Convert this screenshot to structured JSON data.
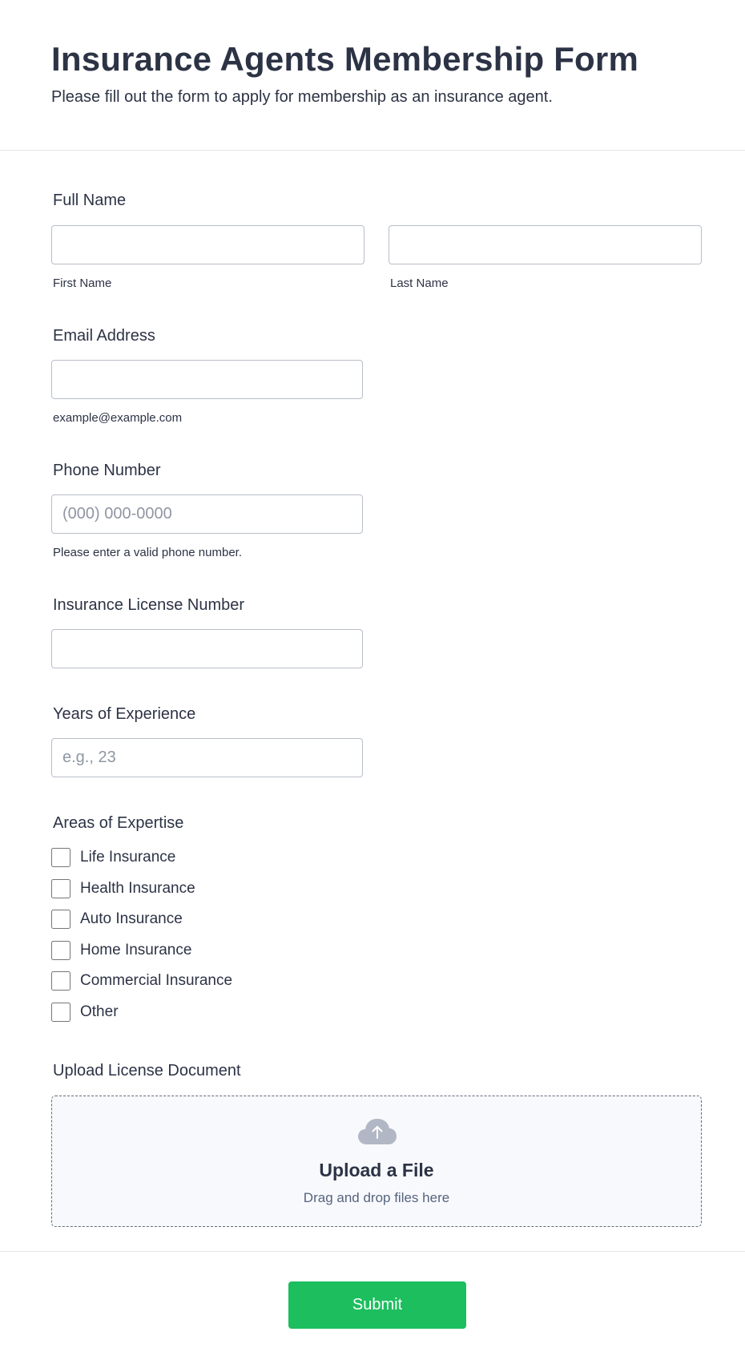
{
  "header": {
    "title": "Insurance Agents Membership Form",
    "subtitle": "Please fill out the form to apply for membership as an insurance agent."
  },
  "full_name": {
    "label": "Full Name",
    "first": {
      "value": "",
      "placeholder": "",
      "sublabel": "First Name"
    },
    "last": {
      "value": "",
      "placeholder": "",
      "sublabel": "Last Name"
    }
  },
  "email": {
    "label": "Email Address",
    "value": "",
    "placeholder": "",
    "sublabel": "example@example.com"
  },
  "phone": {
    "label": "Phone Number",
    "value": "",
    "placeholder": "(000) 000-0000",
    "sublabel": "Please enter a valid phone number."
  },
  "license": {
    "label": "Insurance License Number",
    "value": "",
    "placeholder": ""
  },
  "experience": {
    "label": "Years of Experience",
    "value": "",
    "placeholder": "e.g., 23"
  },
  "expertise": {
    "label": "Areas of Expertise",
    "options": [
      {
        "label": "Life Insurance",
        "checked": false
      },
      {
        "label": "Health Insurance",
        "checked": false
      },
      {
        "label": "Auto Insurance",
        "checked": false
      },
      {
        "label": "Home Insurance",
        "checked": false
      },
      {
        "label": "Commercial Insurance",
        "checked": false
      },
      {
        "label": "Other",
        "checked": false
      }
    ]
  },
  "upload": {
    "label": "Upload License Document",
    "title": "Upload a File",
    "subtitle": "Drag and drop files here",
    "icon": "cloud-upload-icon"
  },
  "submit": {
    "label": "Submit"
  },
  "colors": {
    "text": "#2c3345",
    "accent": "#1cbe5e",
    "input_border": "#b8bdc9",
    "placeholder": "#8f96a3",
    "upload_icon": "#b1b7c4"
  }
}
